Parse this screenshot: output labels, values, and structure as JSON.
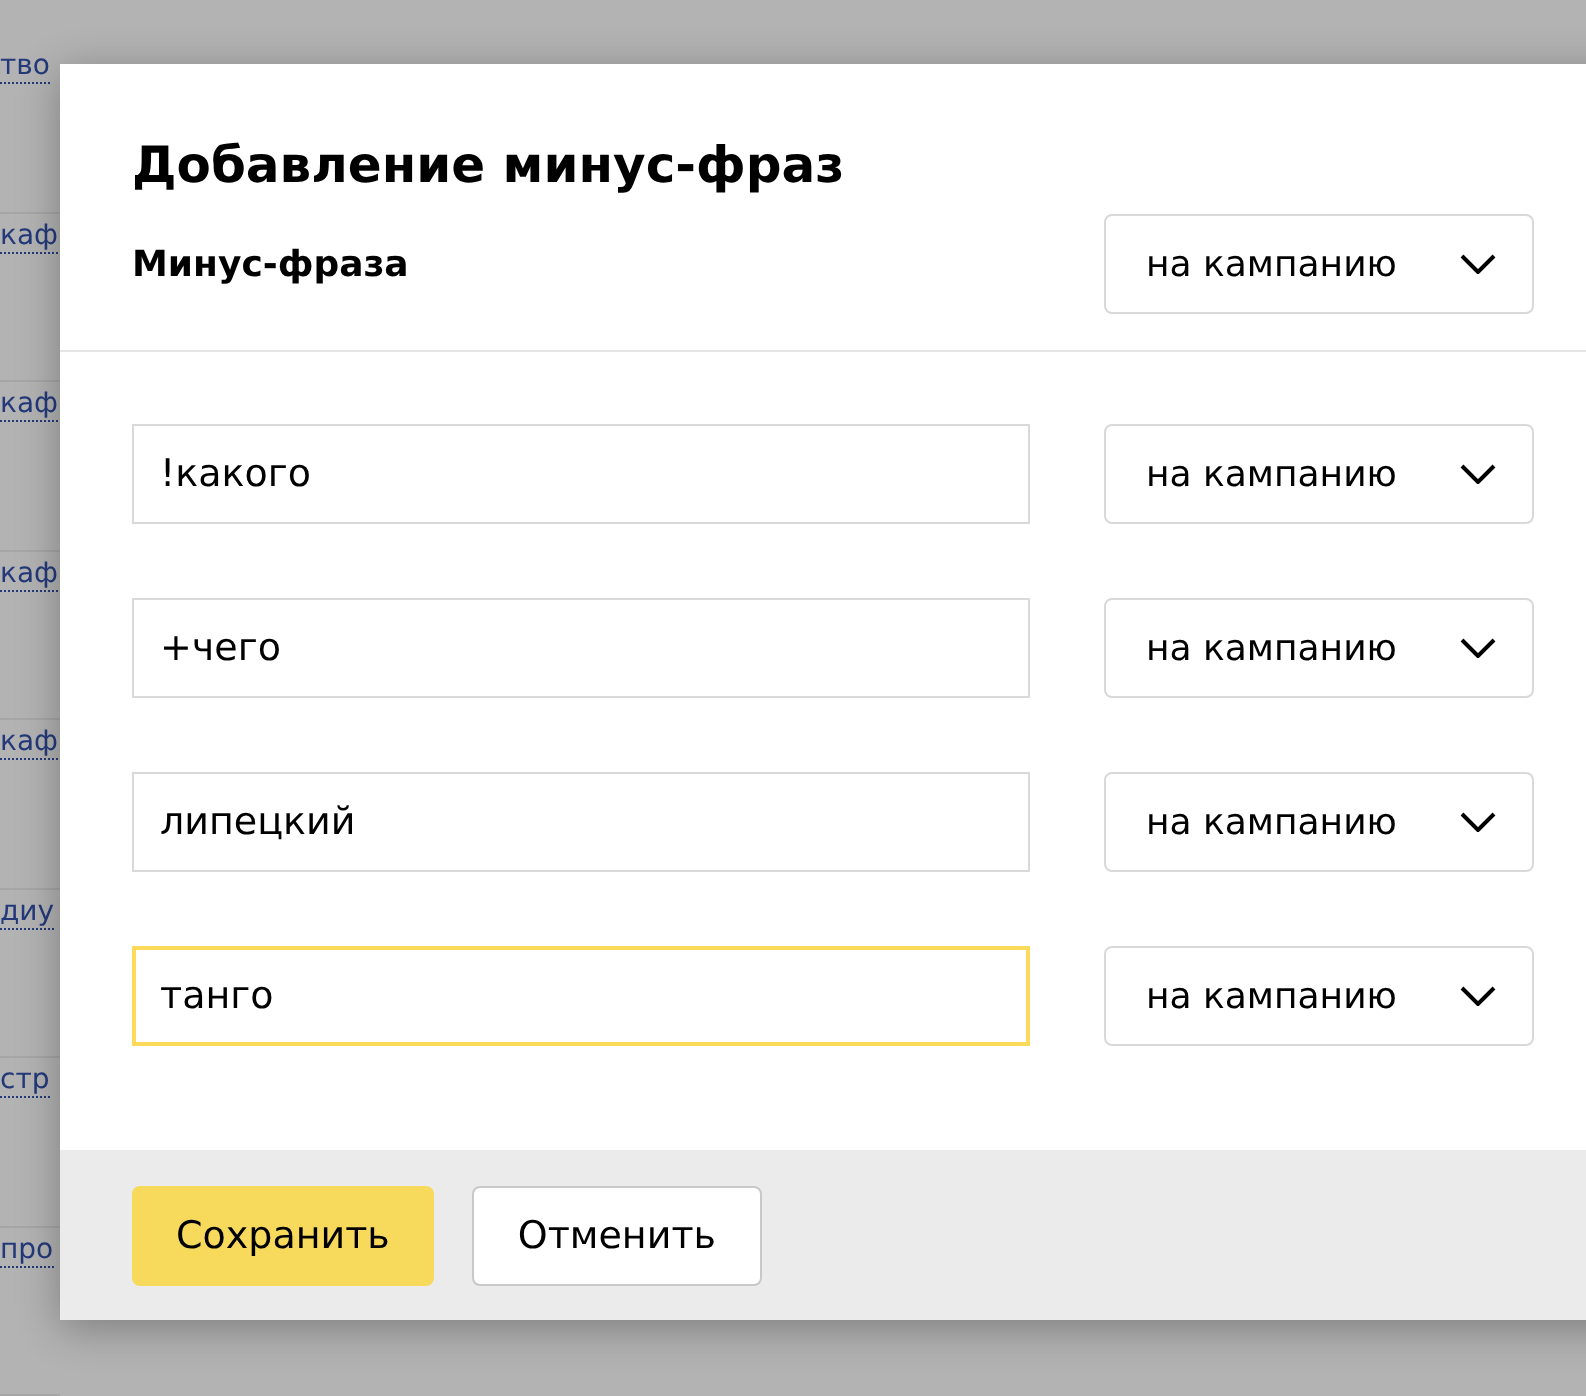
{
  "background": {
    "links": [
      "тво",
      "каф",
      "каф",
      "каф",
      "каф",
      "диу",
      "стр",
      "про"
    ]
  },
  "dialog": {
    "title": "Добавление минус-фраз",
    "header": {
      "label": "Минус-фраза",
      "scope": "на кампанию"
    },
    "rows": [
      {
        "value": "!какого",
        "scope": "на кампанию",
        "focused": false
      },
      {
        "value": "+чего",
        "scope": "на кампанию",
        "focused": false
      },
      {
        "value": "липецкий",
        "scope": "на кампанию",
        "focused": false
      },
      {
        "value": "танго",
        "scope": "на кампанию",
        "focused": true
      }
    ],
    "buttons": [
      {
        "label": "Сохранить",
        "kind": "primary"
      },
      {
        "label": "Отменить",
        "kind": "secondary"
      }
    ]
  }
}
